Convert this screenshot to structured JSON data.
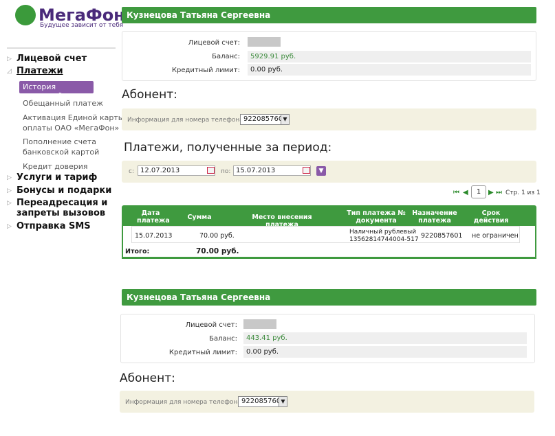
{
  "brand": {
    "name": "МегаФон",
    "tagline": "Будущее зависит от тебя"
  },
  "sidebar": {
    "items": [
      {
        "label": "Лицевой счет"
      },
      {
        "label": "Платежи"
      },
      {
        "label": "Услуги и тариф"
      },
      {
        "label": "Бонусы и подарки"
      },
      {
        "label": "Переадресация и"
      },
      {
        "label": "запреты вызовов"
      },
      {
        "label": "Отправка SMS"
      }
    ],
    "sub": [
      {
        "label": "История платежей"
      },
      {
        "label": "Обещанный платеж"
      },
      {
        "label": "Активация Единой карты"
      },
      {
        "label": "оплаты ОАО «МегаФон»"
      },
      {
        "label": "Пополнение счета"
      },
      {
        "label": "банковской картой"
      },
      {
        "label": "Кредит доверия"
      }
    ]
  },
  "block1": {
    "name": "Кузнецова Татьяна Сергеевна",
    "account_label": "Лицевой счет:",
    "balance_label": "Баланс:",
    "balance": "5929.91 руб.",
    "credit_label": "Кредитный лимит:",
    "credit": "0.00 руб.",
    "subscriber_title": "Абонент:",
    "phone_label": "Информация для номера телефона:",
    "phone": "9220857601"
  },
  "payments": {
    "title": "Платежи, полученные за период:",
    "from_label": "с:",
    "from_date": "12.07.2013",
    "to_label": "по:",
    "to_date": "15.07.2013",
    "page": "1",
    "page_info": "Стр. 1 из 1",
    "columns": [
      "Дата",
      "платежа",
      "Сумма",
      "Место внесения платежа",
      "Тип платежа №",
      "документа",
      "Назначение",
      "платежа",
      "Срок",
      "действия"
    ],
    "row": {
      "date": "15.07.2013",
      "sum": "70.00 руб.",
      "type1": "Наличный рублевый",
      "type2": "13562814744004-517",
      "purpose": "9220857601",
      "term": "не ограничен"
    },
    "total_label": "Итого:",
    "total": "70.00 руб."
  },
  "block2": {
    "name": "Кузнецова Татьяна Сергеевна",
    "account_label": "Лицевой счет:",
    "balance_label": "Баланс:",
    "balance": "443.41 руб.",
    "credit_label": "Кредитный лимит:",
    "credit": "0.00 руб.",
    "subscriber_title": "Абонент:",
    "phone_label": "Информация для номера телефона:",
    "phone": "9220857601"
  },
  "colors": {
    "green": "#3f9a3f",
    "purple": "#8a5aa8",
    "beige": "#f3f1e1"
  }
}
